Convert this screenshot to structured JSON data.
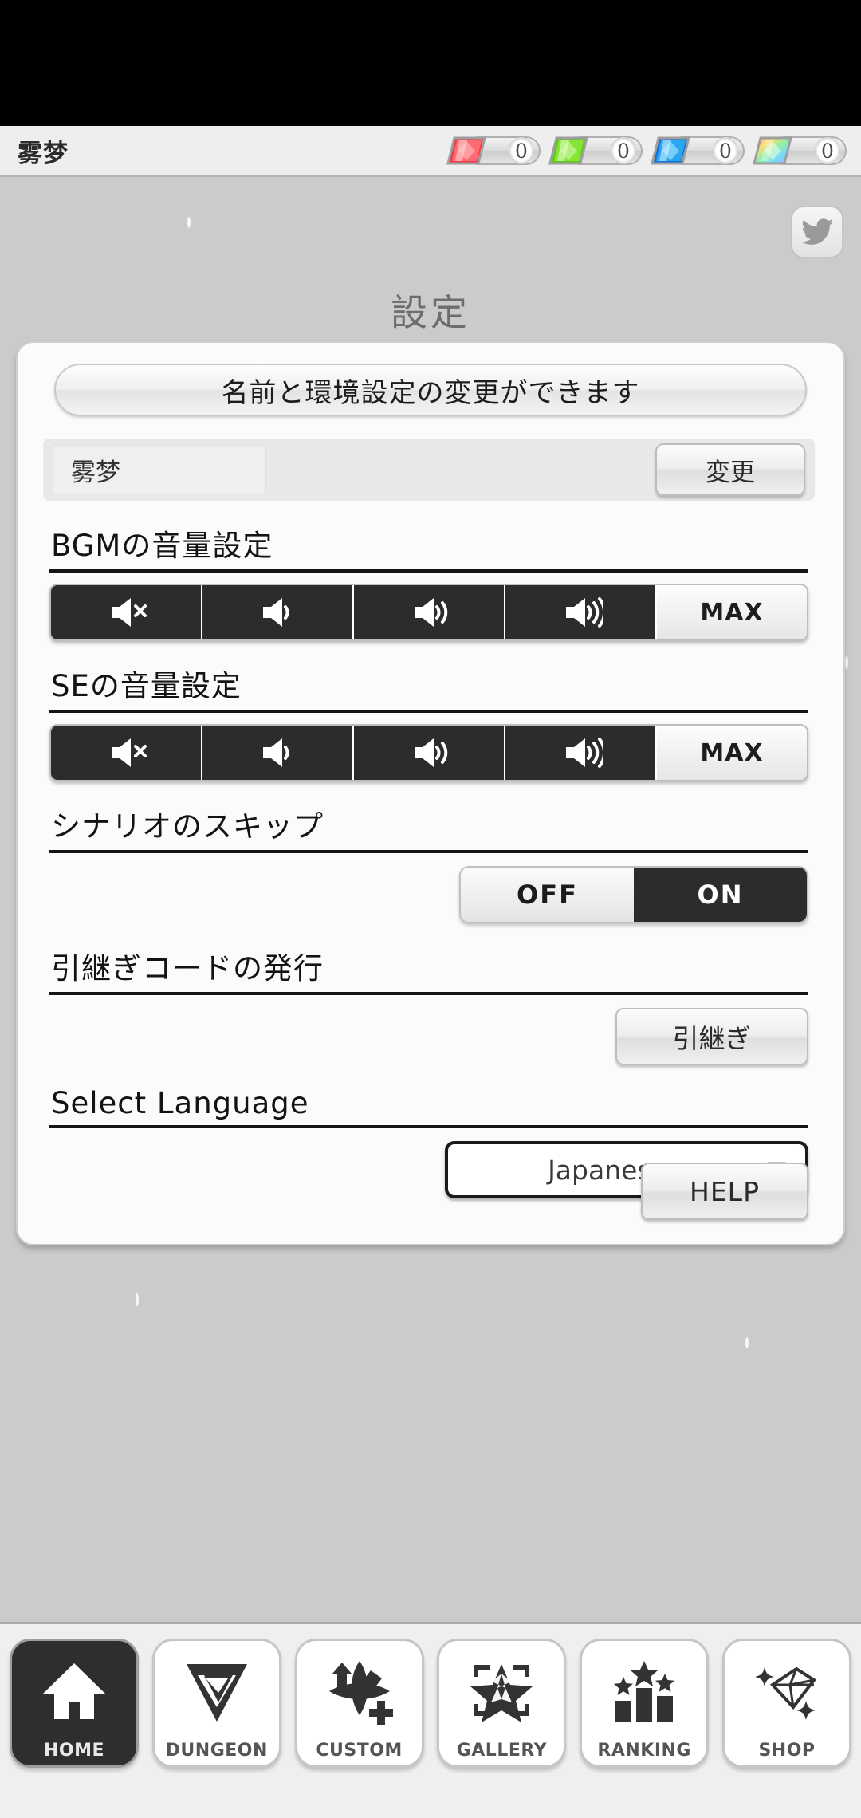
{
  "header": {
    "player_name": "雾梦",
    "currencies": [
      {
        "icon": "red-gem-icon",
        "color": "#f0404a",
        "value": "0"
      },
      {
        "icon": "green-gem-icon",
        "color": "#6ed82a",
        "value": "0"
      },
      {
        "icon": "blue-gem-icon",
        "color": "#1b9df0",
        "value": "0"
      },
      {
        "icon": "rainbow-gem-icon",
        "color": "#b8e0e8",
        "value": "0"
      }
    ]
  },
  "page": {
    "title": "設定",
    "twitter_button": "twitter-icon"
  },
  "settings": {
    "banner": "名前と環境設定の変更ができます",
    "name": {
      "value": "雾梦",
      "placeholder": "",
      "change_label": "変更"
    },
    "bgm": {
      "label": "BGMの音量設定",
      "segments": [
        "mute",
        "low",
        "mid",
        "high",
        "MAX"
      ],
      "max_label": "MAX",
      "selected_index": 4
    },
    "se": {
      "label": "SEの音量設定",
      "segments": [
        "mute",
        "low",
        "mid",
        "high",
        "MAX"
      ],
      "max_label": "MAX",
      "selected_index": 4
    },
    "skip": {
      "label": "シナリオのスキップ",
      "off_label": "OFF",
      "on_label": "ON",
      "selected": "OFF"
    },
    "takeover": {
      "label": "引継ぎコードの発行",
      "button_label": "引継ぎ"
    },
    "language": {
      "label": "Select Language",
      "selected": "Japanese",
      "caret": "▼"
    },
    "help_label": "HELP"
  },
  "nav": {
    "items": [
      {
        "label": "HOME",
        "icon": "home-icon",
        "active": true
      },
      {
        "label": "DUNGEON",
        "icon": "dungeon-icon",
        "active": false
      },
      {
        "label": "CUSTOM",
        "icon": "custom-icon",
        "active": false
      },
      {
        "label": "GALLERY",
        "icon": "gallery-icon",
        "active": false
      },
      {
        "label": "RANKING",
        "icon": "ranking-icon",
        "active": false
      },
      {
        "label": "SHOP",
        "icon": "shop-icon",
        "active": false
      }
    ]
  }
}
